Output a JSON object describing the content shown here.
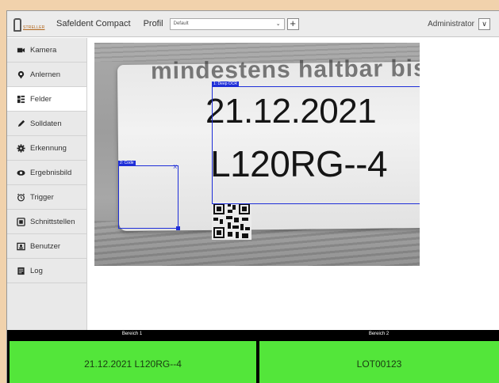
{
  "header": {
    "logo_text": "STRELLER",
    "app_title": "Safeldent Compact",
    "profile_label": "Profil",
    "profile_value": "Default",
    "add_button": "+",
    "user": "Administrator",
    "user_toggle": "∨"
  },
  "sidebar": {
    "items": [
      {
        "label": "Kamera",
        "icon": "camera-icon"
      },
      {
        "label": "Anlernen",
        "icon": "location-pin-icon"
      },
      {
        "label": "Felder",
        "icon": "fields-icon"
      },
      {
        "label": "Solldaten",
        "icon": "pencil-icon"
      },
      {
        "label": "Erkennung",
        "icon": "gear-icon"
      },
      {
        "label": "Ergebnisbild",
        "icon": "eye-icon"
      },
      {
        "label": "Trigger",
        "icon": "alarm-clock-icon"
      },
      {
        "label": "Schnittstellen",
        "icon": "interface-icon"
      },
      {
        "label": "Benutzer",
        "icon": "user-card-icon"
      },
      {
        "label": "Log",
        "icon": "log-icon"
      }
    ],
    "active_item": "Felder"
  },
  "viewer": {
    "label_top_text": "mindestens haltbar bis:",
    "ocr_line_1": "21.12.2021",
    "ocr_line_2": "L120RG--4",
    "regions": [
      {
        "label": "1: Deep OCR",
        "close": "X"
      },
      {
        "label": "2: Code",
        "close": "X"
      }
    ]
  },
  "results": [
    {
      "header": "Bereich 1",
      "value": "21.12.2021 L120RG--4"
    },
    {
      "header": "Bereich 2",
      "value": "LOT00123"
    }
  ],
  "colors": {
    "accent": "#1e2ed8",
    "result_ok": "#53e63a",
    "background": "#f1d2ac"
  }
}
